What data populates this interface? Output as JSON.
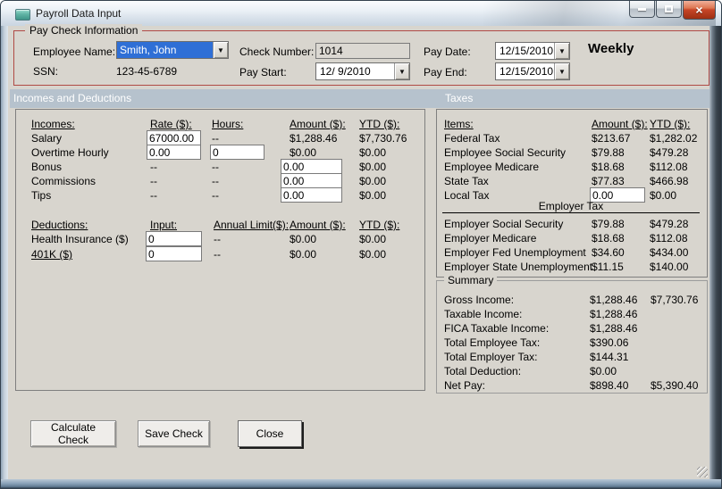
{
  "window": {
    "title": "Payroll Data Input"
  },
  "icons": {
    "dropdown_arrow": "▼",
    "close_glyph": "×"
  },
  "paycheck": {
    "group_title": "Pay Check Information",
    "employee_name": {
      "label": "Employee Name:",
      "value": "Smith, John"
    },
    "ssn": {
      "label": "SSN:",
      "value": "123-45-6789"
    },
    "check_number": {
      "label": "Check Number:",
      "value": "1014"
    },
    "pay_start": {
      "label": "Pay Start:",
      "value": "12/ 9/2010"
    },
    "pay_date": {
      "label": "Pay Date:",
      "value": "12/15/2010"
    },
    "pay_end": {
      "label": "Pay End:",
      "value": "12/15/2010"
    },
    "frequency": "Weekly"
  },
  "section_headers": {
    "left": "Incomes and Deductions",
    "right": "Taxes"
  },
  "incomes": {
    "headers": {
      "item": "Incomes:",
      "rate": "Rate ($):",
      "hours": "Hours:",
      "amount": "Amount ($):",
      "ytd": "YTD ($):"
    },
    "rows": [
      {
        "label": "Salary",
        "rate": "67000.00",
        "hours": "--",
        "amount": "$1,288.46",
        "ytd": "$7,730.76"
      },
      {
        "label": "Overtime Hourly",
        "rate": "0.00",
        "hours": "0",
        "amount": "$0.00",
        "ytd": "$0.00"
      },
      {
        "label": "Bonus",
        "rate": "--",
        "hours": "--",
        "amount": "0.00",
        "ytd": "$0.00"
      },
      {
        "label": "Commissions",
        "rate": "--",
        "hours": "--",
        "amount": "0.00",
        "ytd": "$0.00"
      },
      {
        "label": "Tips",
        "rate": "--",
        "hours": "--",
        "amount": "0.00",
        "ytd": "$0.00"
      }
    ]
  },
  "deductions": {
    "headers": {
      "item": "Deductions:",
      "input": "Input:",
      "annual_limit": "Annual Limit($):",
      "amount": "Amount ($):",
      "ytd": "YTD ($):"
    },
    "rows": [
      {
        "label": "Health Insurance  ($)",
        "input": "0",
        "annual_limit": "--",
        "amount": "$0.00",
        "ytd": "$0.00"
      },
      {
        "label": "401K  ($)",
        "input": "0",
        "annual_limit": "--",
        "amount": "$0.00",
        "ytd": "$0.00"
      }
    ]
  },
  "taxes": {
    "headers": {
      "item": "Items:",
      "amount": "Amount ($):",
      "ytd": "YTD ($):"
    },
    "employee_rows": [
      {
        "label": "Federal Tax",
        "amount": "$213.67",
        "ytd": "$1,282.02"
      },
      {
        "label": "Employee Social Security",
        "amount": "$79.88",
        "ytd": "$479.28"
      },
      {
        "label": "Employee Medicare",
        "amount": "$18.68",
        "ytd": "$112.08"
      },
      {
        "label": "State Tax",
        "amount": "$77.83",
        "ytd": "$466.98"
      },
      {
        "label": "Local Tax",
        "amount": "0.00",
        "ytd": "$0.00"
      }
    ],
    "employer_divider": "Employer Tax",
    "employer_rows": [
      {
        "label": "Employer Social Security",
        "amount": "$79.88",
        "ytd": "$479.28"
      },
      {
        "label": "Employer Medicare",
        "amount": "$18.68",
        "ytd": "$112.08"
      },
      {
        "label": "Employer Fed Unemployment",
        "amount": "$34.60",
        "ytd": "$434.00"
      },
      {
        "label": "Employer State Unemployment",
        "amount": "$11.15",
        "ytd": "$140.00"
      }
    ]
  },
  "summary": {
    "group_title": "Summary",
    "rows": [
      {
        "label": "Gross Income:",
        "amount": "$1,288.46",
        "ytd": "$7,730.76"
      },
      {
        "label": "Taxable Income:",
        "amount": "$1,288.46",
        "ytd": ""
      },
      {
        "label": "FICA Taxable Income:",
        "amount": "$1,288.46",
        "ytd": ""
      },
      {
        "label": "Total Employee Tax:",
        "amount": "$390.06",
        "ytd": ""
      },
      {
        "label": "Total Employer Tax:",
        "amount": "$144.31",
        "ytd": ""
      },
      {
        "label": "Total Deduction:",
        "amount": "$0.00",
        "ytd": ""
      },
      {
        "label": "Net Pay:",
        "amount": "$898.40",
        "ytd": "$5,390.40"
      }
    ]
  },
  "buttons": {
    "calculate": "Calculate Check",
    "save": "Save Check",
    "close": "Close"
  },
  "colors": {
    "group_border": "#b04a45",
    "section_band": "#b6c2cd",
    "selection_blue": "#2f6fd6",
    "close_button_red": "#c64527",
    "client_bg": "#d8d5ce"
  }
}
